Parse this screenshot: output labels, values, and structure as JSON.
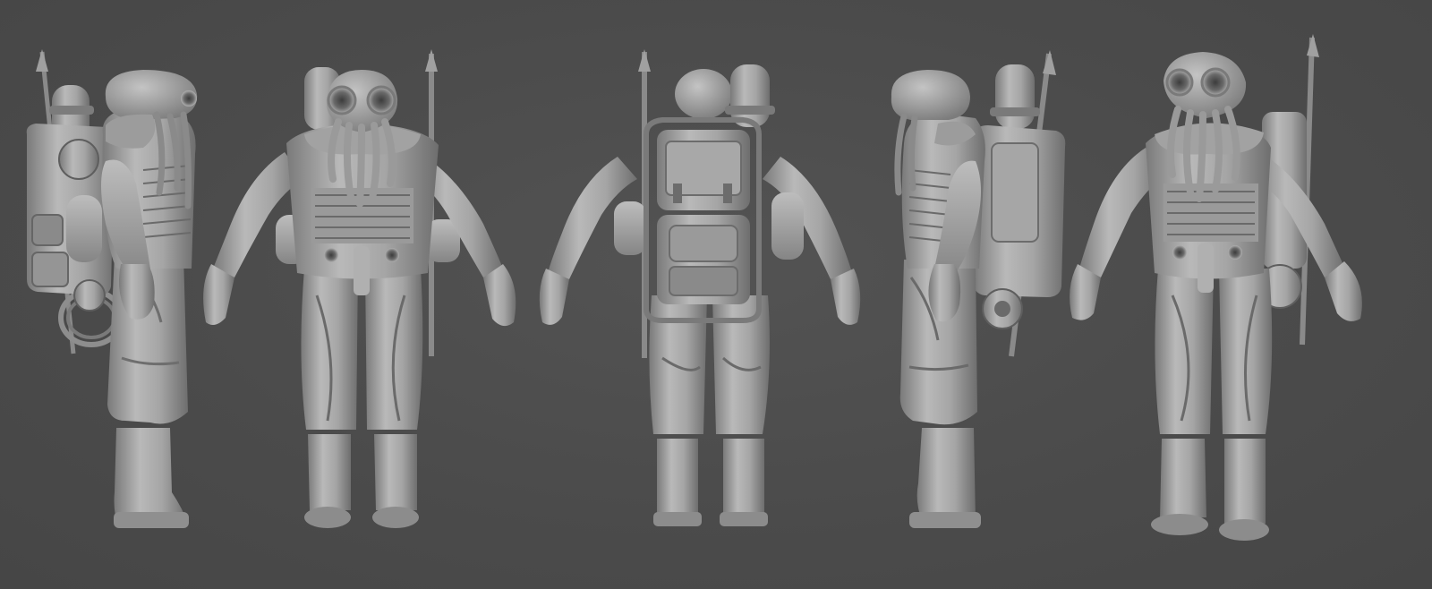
{
  "scene": {
    "background_color": "#4a4a4a",
    "material_light": "#b4b4b4",
    "material_mid": "#909090",
    "material_shadow": "#6c6c6c",
    "material_dark": "#525252",
    "views": [
      {
        "view": "left-profile"
      },
      {
        "view": "front"
      },
      {
        "view": "back"
      },
      {
        "view": "right-profile"
      },
      {
        "view": "three-quarter-front"
      }
    ]
  }
}
